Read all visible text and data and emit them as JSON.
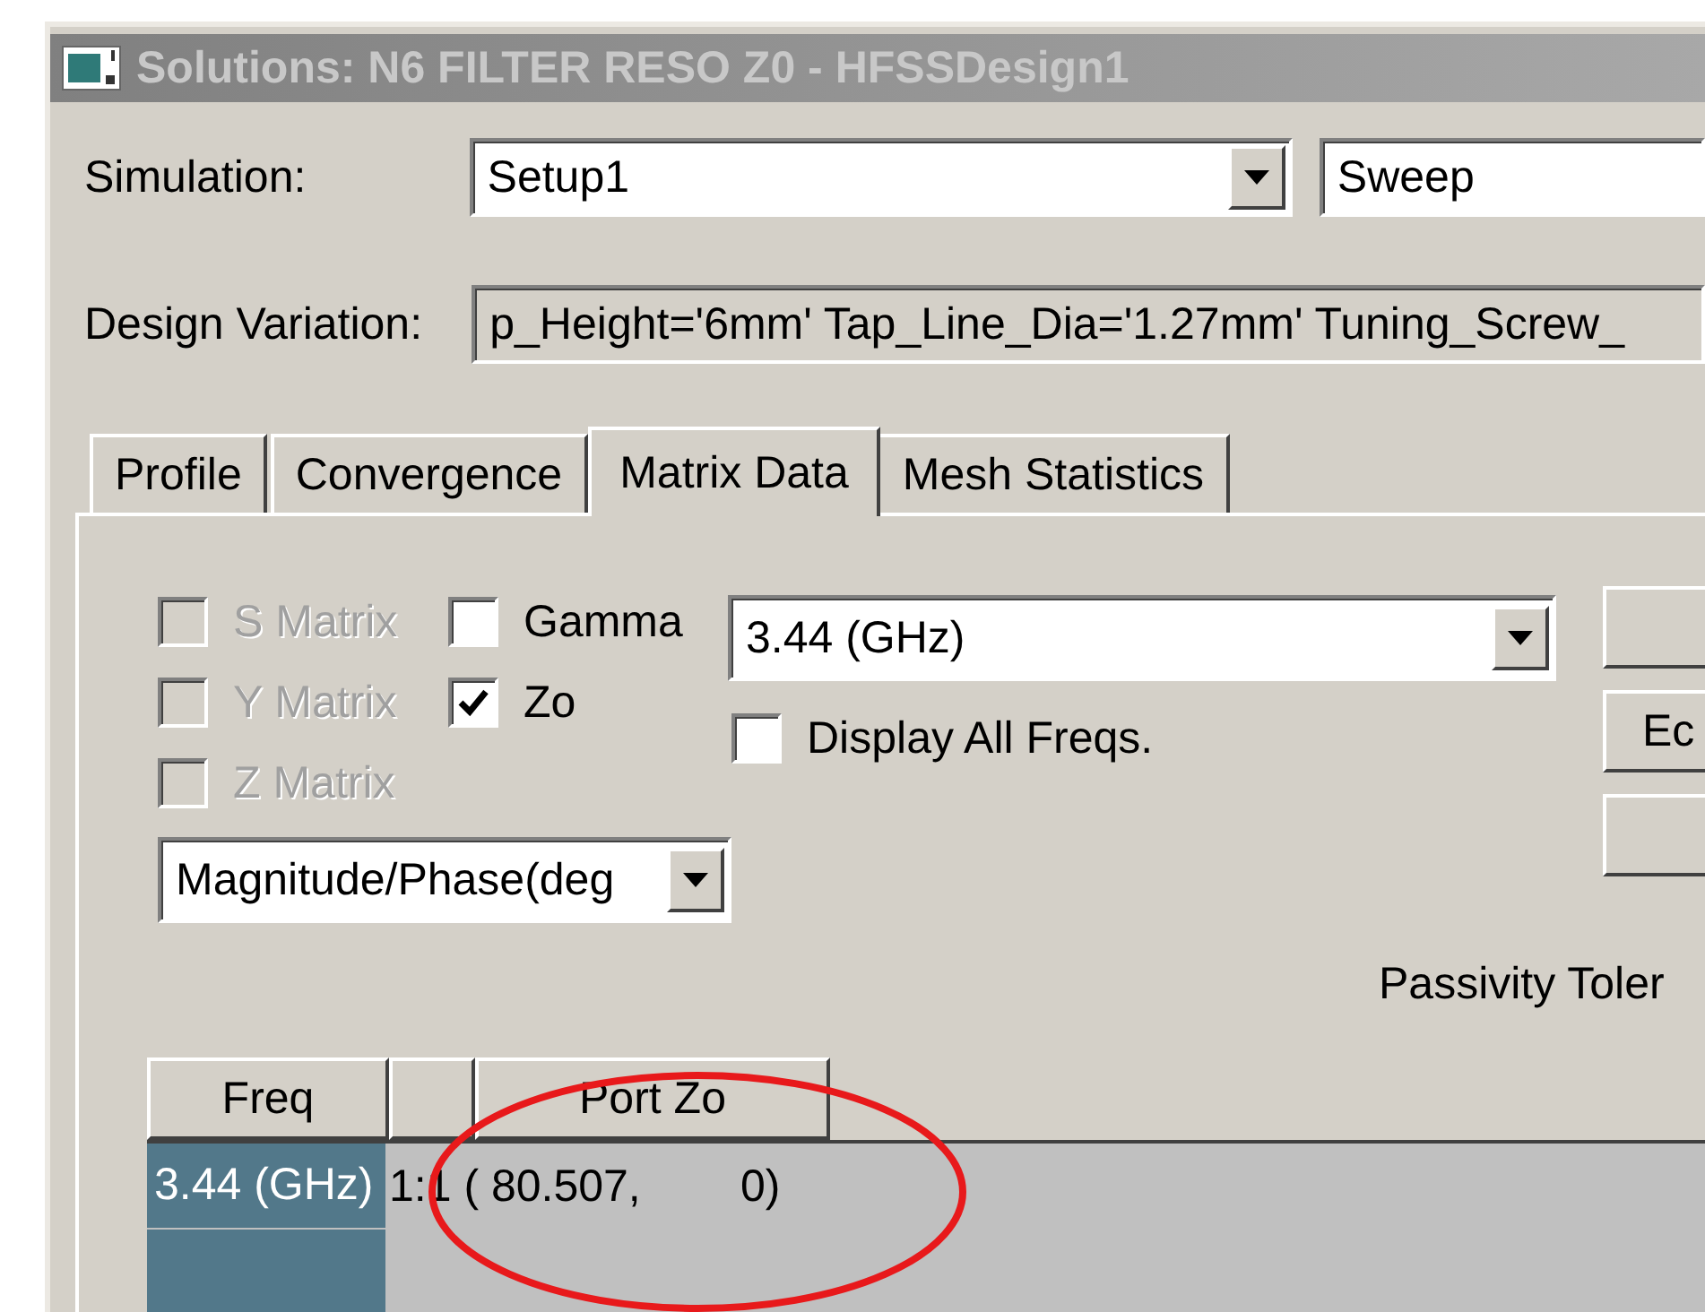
{
  "window": {
    "title": "Solutions: N6 FILTER RESO Z0 - HFSSDesign1"
  },
  "simulation": {
    "label": "Simulation:",
    "setup": "Setup1",
    "sweep": "Sweep"
  },
  "design_variation": {
    "label": "Design Variation:",
    "value": "p_Height='6mm' Tap_Line_Dia='1.27mm' Tuning_Screw_"
  },
  "tabs": [
    {
      "label": "Profile",
      "selected": false
    },
    {
      "label": "Convergence",
      "selected": false
    },
    {
      "label": "Matrix Data",
      "selected": true
    },
    {
      "label": "Mesh Statistics",
      "selected": false
    }
  ],
  "matrix_options": [
    {
      "label": "S Matrix",
      "checked": false,
      "disabled": true
    },
    {
      "label": "Gamma",
      "checked": false,
      "disabled": false
    },
    {
      "label": "Y Matrix",
      "checked": false,
      "disabled": true
    },
    {
      "label": "Zo",
      "checked": true,
      "disabled": false
    },
    {
      "label": "Z Matrix",
      "checked": false,
      "disabled": true
    }
  ],
  "format": {
    "value": "Magnitude/Phase(deg"
  },
  "frequency": {
    "value": "3.44 (GHz)"
  },
  "display_all_freqs": {
    "label": "Display All Freqs.",
    "checked": false
  },
  "side_buttons": [
    {
      "kind": "blank"
    },
    {
      "kind": "text",
      "label": "Ec"
    },
    {
      "kind": "blank"
    }
  ],
  "passivity": {
    "label": "Passivity Toler"
  },
  "table": {
    "columns": [
      {
        "kind": "text",
        "label": "Freq"
      },
      {
        "kind": "blank"
      },
      {
        "kind": "text",
        "label": "Port Zo"
      }
    ],
    "rows": [
      {
        "freq": "3.44 (GHz)",
        "value": "1:1 ( 80.507,        0)"
      }
    ]
  },
  "annotation": {
    "kind": "ellipse"
  }
}
